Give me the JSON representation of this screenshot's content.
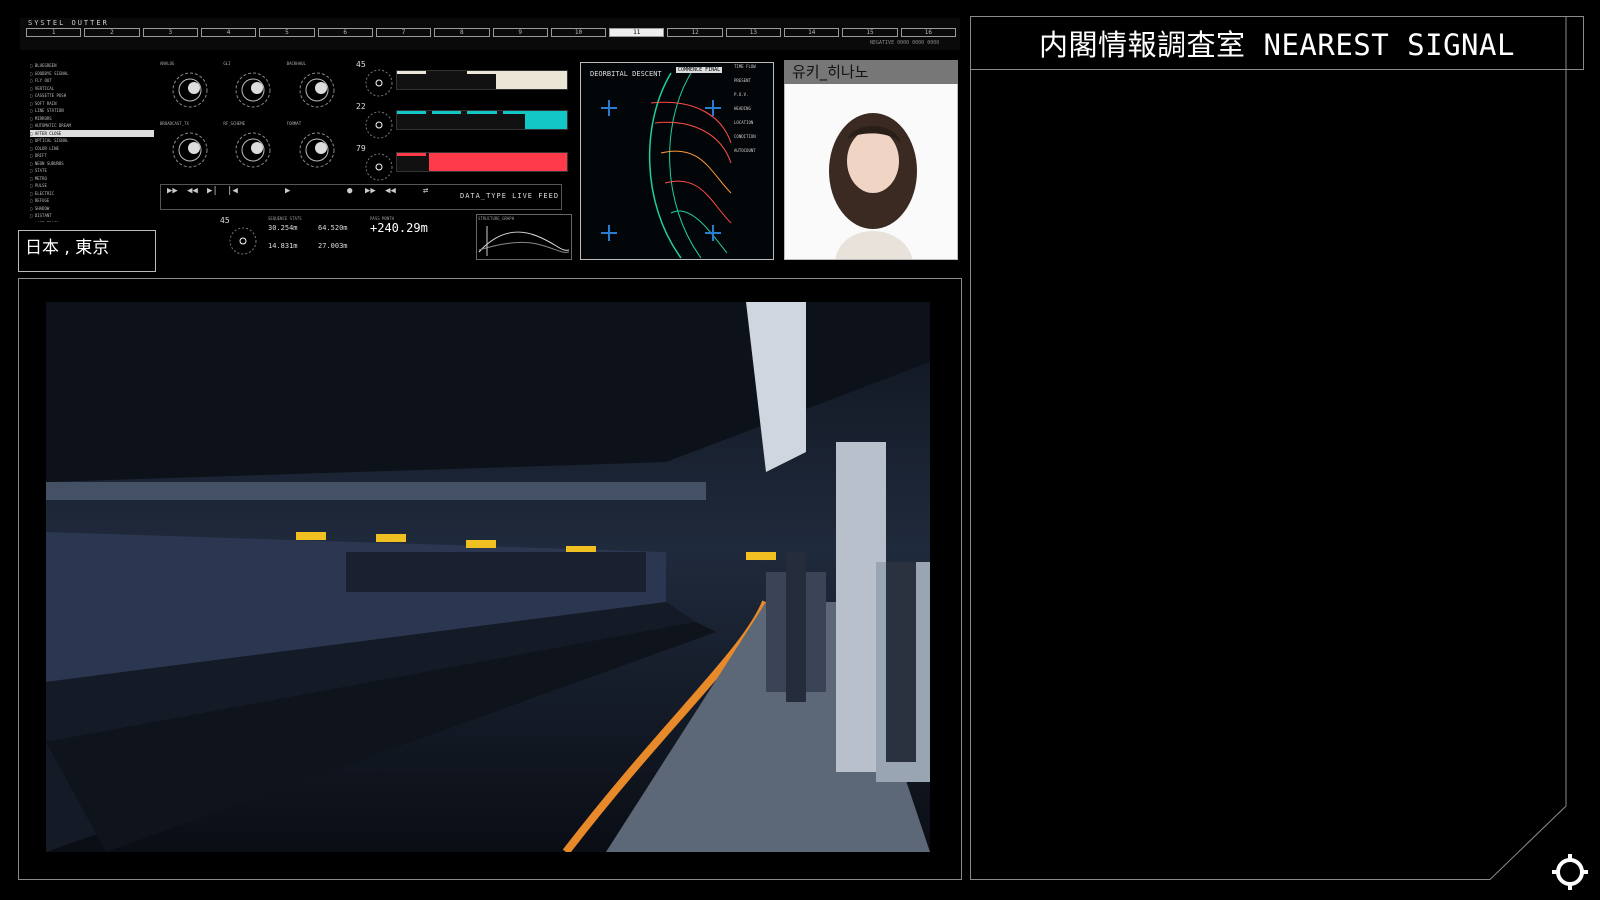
{
  "header": {
    "system_title": "SYSTEL OUTTER",
    "sub_text": "NEGATIVE 0000 0000 0000"
  },
  "segments": [
    "1",
    "2",
    "3",
    "4",
    "5",
    "6",
    "7",
    "8",
    "9",
    "10",
    "11",
    "12",
    "13",
    "14",
    "15",
    "16"
  ],
  "active_segment_index": 10,
  "track_list": [
    "BLUEGREEN",
    "GOODBYE SIGNAL",
    "FLY OUT",
    "VERTICAL",
    "CASSETTE PUSH",
    "SOFT RAIN",
    "LINE STATION",
    "MIRRORS",
    "AUTOMATIC DREAM",
    "AFTER CLOSE",
    "OPTICAL SIGNAL",
    "COLOR LINE",
    "DRIFT",
    "NEON SUBURBS",
    "STATE",
    "METRO",
    "PULSE",
    "ELECTRIC",
    "REFUGE",
    "SHADOW",
    "DISTANT",
    "LAST TRAIN"
  ],
  "track_list_selected_index": 9,
  "gauges": [
    {
      "label": "ANALOG"
    },
    {
      "label": "GLI"
    },
    {
      "label": "BACKHAUL"
    },
    {
      "label": "BROADCAST_TX"
    },
    {
      "label": "RF_SCHEME"
    },
    {
      "label": "FORMAT"
    }
  ],
  "dials": [
    {
      "value": "45"
    },
    {
      "value": "22"
    },
    {
      "value": "79"
    },
    {
      "value": "45"
    }
  ],
  "bar_colors": [
    "#ece6d6",
    "#13c7c7",
    "#ff3a4a"
  ],
  "bar_levels": [
    0.42,
    0.25,
    0.81
  ],
  "data_type": "DATA_TYPE  LIVE FEED",
  "stats": {
    "header": "SEQUENCE STATS",
    "values": [
      "30.254m",
      "64.520m",
      "14.831m",
      "27.003m"
    ]
  },
  "big_value": {
    "header": "PASS MONTH",
    "value": "+240.29m"
  },
  "spark_header": "STRUCTURE_GRAPH",
  "map": {
    "title": "DEORBITAL DESCENT",
    "tag": "COMMENCE FINAL",
    "side": [
      "TIME FLOW",
      "PRESENT",
      "P.O.V.",
      "HEADING",
      "LOCATION",
      "CONDITION",
      "AUTOCOUNT"
    ]
  },
  "profile": {
    "name": "유키_히나노"
  },
  "location": "日本 , 東京",
  "right_panel": {
    "title": "内閣情報調査室 NEAREST SIGNAL"
  },
  "colors": {
    "accent_orange": "#e98a2a",
    "frame": "#8a8a8a"
  }
}
